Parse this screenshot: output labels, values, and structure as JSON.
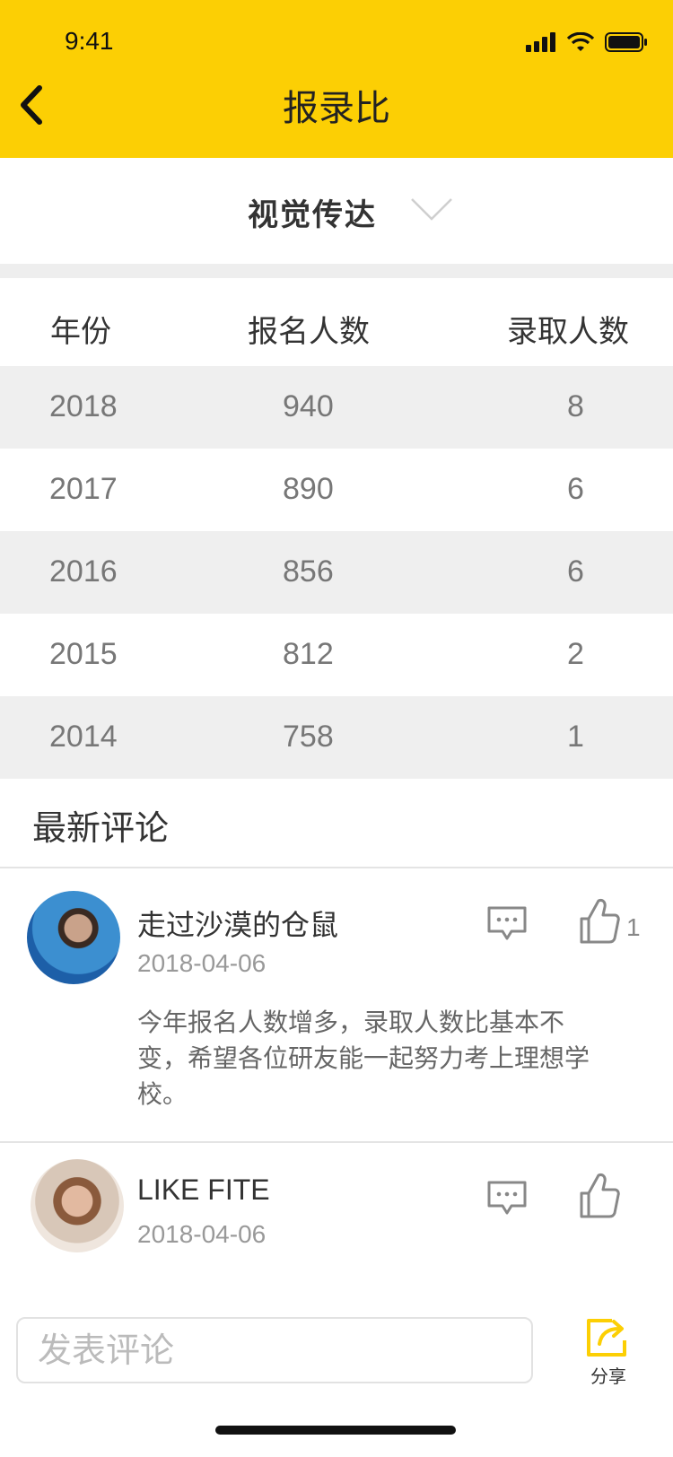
{
  "status_bar": {
    "time": "9:41"
  },
  "nav": {
    "title": "报录比"
  },
  "selector": {
    "value": "视觉传达"
  },
  "table": {
    "headers": [
      "年份",
      "报名人数",
      "录取人数"
    ],
    "rows": [
      {
        "year": "2018",
        "registered": "940",
        "admitted": "8"
      },
      {
        "year": "2017",
        "registered": "890",
        "admitted": "6"
      },
      {
        "year": "2016",
        "registered": "856",
        "admitted": "6"
      },
      {
        "year": "2015",
        "registered": "812",
        "admitted": "2"
      },
      {
        "year": "2014",
        "registered": "758",
        "admitted": "1"
      }
    ]
  },
  "comments_section": {
    "title": "最新评论"
  },
  "comments": [
    {
      "name": "走过沙漠的仓鼠",
      "date": "2018-04-06",
      "body": "今年报名人数增多，录取人数比基本不变，希望各位研友能一起努力考上理想学校。",
      "likes": "1"
    },
    {
      "name": "LIKE FITE",
      "date": "2018-04-06"
    }
  ],
  "bottom_bar": {
    "input_placeholder": "发表评论",
    "share_label": "分享"
  },
  "colors": {
    "accent": "#FCCF04",
    "stripe": "#EFEFEF"
  }
}
